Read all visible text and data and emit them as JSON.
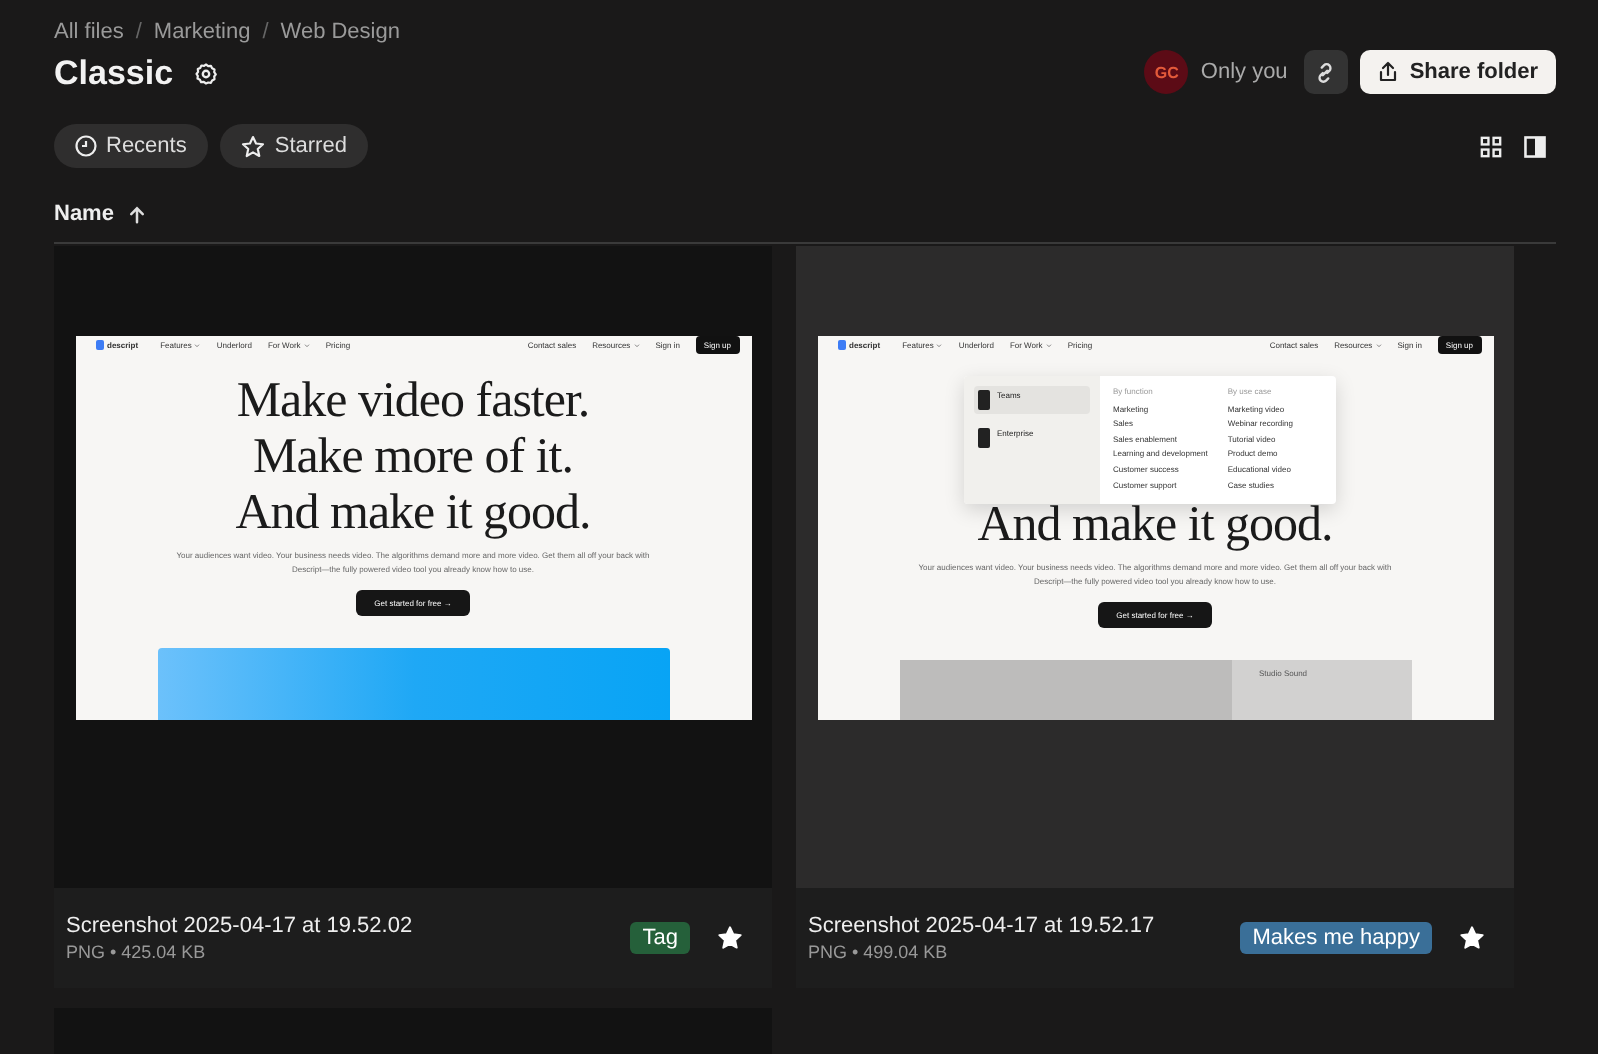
{
  "breadcrumbs": {
    "separator": "/",
    "items": [
      "All files",
      "Marketing",
      "Web Design"
    ]
  },
  "folder": {
    "title": "Classic"
  },
  "owner": {
    "initials": "GC",
    "color": "#5c0b16",
    "label": "Only you"
  },
  "share_button": "Share folder",
  "filters": [
    {
      "label": "Recents",
      "kind": "clock"
    },
    {
      "label": "Starred",
      "kind": "star"
    }
  ],
  "sort": {
    "column": "Name",
    "ascending": true
  },
  "files": [
    {
      "name": "Screenshot 2025-04-17 at 19.52.02",
      "meta": "PNG • 425.04 KB",
      "selected": false,
      "starred": true,
      "tag": {
        "label": "Tag",
        "color": "#25603a"
      },
      "preview": {
        "logo": "descript",
        "nav": [
          {
            "label": "Features",
            "dropdown": true
          },
          {
            "label": "Underlord",
            "dropdown": false
          },
          {
            "label": "For Work",
            "dropdown": true
          },
          {
            "label": "Pricing",
            "dropdown": false
          }
        ],
        "nav_right": [
          {
            "label": "Contact sales",
            "dropdown": false
          },
          {
            "label": "Resources",
            "dropdown": true
          },
          {
            "label": "Sign in",
            "dropdown": false
          }
        ],
        "signup": "Sign up",
        "headline": [
          "Make video faster.",
          "Make more of it.",
          "And make it good."
        ],
        "body": "Your audiences want video. Your business needs video. The algorithms demand more and more video. Get them all off your back with Descript—the fully powered video tool you already know how to use.",
        "cta": "Get started for free →",
        "hero": {
          "kind": "gradient"
        }
      }
    },
    {
      "name": "Screenshot 2025-04-17 at 19.52.17",
      "meta": "PNG • 499.04 KB",
      "selected": true,
      "starred": true,
      "tag": {
        "label": "Makes me happy",
        "color": "#3a6f98"
      },
      "preview": {
        "logo": "descript",
        "nav": [
          {
            "label": "Features",
            "dropdown": true
          },
          {
            "label": "Underlord",
            "dropdown": false
          },
          {
            "label": "For Work",
            "dropdown": true
          },
          {
            "label": "Pricing",
            "dropdown": false
          }
        ],
        "nav_right": [
          {
            "label": "Contact sales",
            "dropdown": false
          },
          {
            "label": "Resources",
            "dropdown": true
          },
          {
            "label": "Sign in",
            "dropdown": false
          }
        ],
        "signup": "Sign up",
        "headline": [
          "And make it good."
        ],
        "body": "Your audiences want video. Your business needs video. The algorithms demand more and more video. Get them all off your back with Descript—the fully powered video tool you already know how to use.",
        "cta": "Get started for free →",
        "menu": {
          "featured": [
            {
              "title": "Teams",
              "selected": true
            },
            {
              "title": "Enterprise",
              "selected": false
            }
          ],
          "columns": [
            {
              "heading": "By function",
              "items": [
                "Marketing",
                "Sales",
                "Sales enablement",
                "Learning and development",
                "Customer success",
                "Customer support"
              ]
            },
            {
              "heading": "By use case",
              "items": [
                "Marketing video",
                "Webinar recording",
                "Tutorial video",
                "Product demo",
                "Educational video",
                "Case studies"
              ]
            }
          ]
        },
        "hero": {
          "kind": "app",
          "panel_items": [
            "Studio Sound"
          ]
        }
      }
    },
    {
      "selected": false
    }
  ]
}
